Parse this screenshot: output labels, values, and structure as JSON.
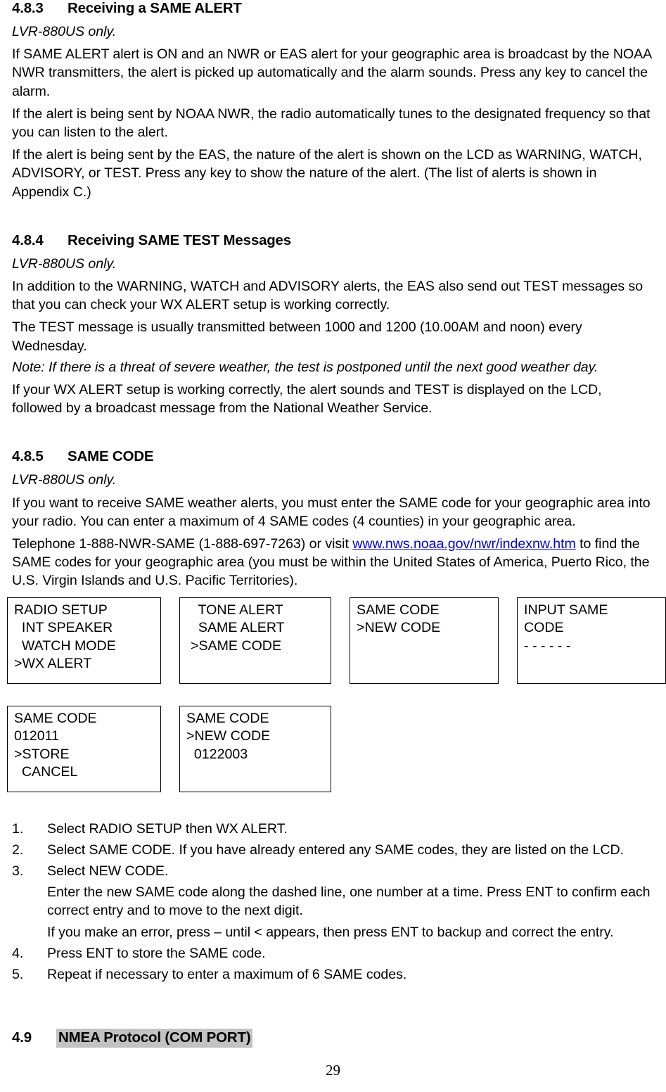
{
  "document": {
    "page_number": "29"
  },
  "sections": {
    "s483": {
      "number": "4.8.3",
      "title": "Receiving a SAME ALERT",
      "note": "LVR-880US only.",
      "paragraphs": [
        "If SAME ALERT alert is ON and an NWR or EAS alert for your geographic area is broadcast by the NOAA NWR transmitters, the alert is picked up automatically and the alarm sounds. Press any key to cancel the alarm.",
        "If the alert is being sent by NOAA NWR, the radio automatically tunes to the designated frequency so that you can listen to the alert.",
        "If the alert is being sent by the EAS, the nature of the alert is shown on the LCD as WARNING, WATCH, ADVISORY, or TEST. Press any key to show the nature of the alert. (The list of alerts is shown in Appendix C.)"
      ]
    },
    "s484": {
      "number": "4.8.4",
      "title": "Receiving SAME TEST Messages",
      "note": "LVR-880US only.",
      "paragraphs": [
        "In addition to the WARNING, WATCH and ADVISORY alerts, the EAS also send out TEST messages so that you can check your WX ALERT setup is working correctly.",
        "The TEST message is usually transmitted between 1000 and 1200 (10.00AM and noon) every Wednesday."
      ],
      "italic_note": "Note: If there is a threat of severe weather, the test is postponed until the next good weather day.",
      "closing": "If your WX ALERT setup is working correctly, the alert sounds and TEST is displayed on the LCD, followed by a broadcast message from the National Weather Service."
    },
    "s485": {
      "number": "4.8.5",
      "title": "SAME CODE",
      "note": "LVR-880US only.",
      "paragraph1": "If you want to receive SAME weather alerts, you must enter the SAME code for your geographic area into your radio. You can enter a maximum of 4 SAME codes (4 counties) in your geographic area.",
      "telephone_pre": "Telephone 1-888-NWR-SAME (1-888-697-7263) or visit ",
      "link_text": "www.nws.noaa.gov/nwr/indexnw.htm",
      "telephone_post": " to find the SAME codes for your geographic area (you must be within the United States of America, Puerto Rico, the U.S. Virgin Islands and U.S. Pacific Territories)."
    },
    "s49": {
      "number": "4.9",
      "title": "NMEA Protocol (COM PORT)",
      "highlight_color": "#c2c2c2"
    }
  },
  "lcd_screens": {
    "row1": [
      {
        "name": "radio-setup",
        "lines": [
          "RADIO SETUP",
          "  INT SPEAKER",
          "  WATCH MODE",
          ">WX ALERT"
        ]
      },
      {
        "name": "tone-alert",
        "lines": [
          "  TONE ALERT",
          "  SAME ALERT",
          ">SAME CODE",
          ""
        ]
      },
      {
        "name": "same-code-new",
        "lines": [
          "SAME CODE",
          ">NEW CODE",
          "",
          ""
        ]
      },
      {
        "name": "input-same-code",
        "lines": [
          "INPUT SAME",
          "CODE",
          "- - - - - -",
          ""
        ]
      }
    ],
    "row2": [
      {
        "name": "same-code-store",
        "lines": [
          "SAME CODE",
          "012011",
          ">STORE",
          "  CANCEL"
        ]
      },
      {
        "name": "same-code-entered",
        "lines": [
          "SAME CODE",
          ">NEW CODE",
          "  0122003",
          ""
        ]
      }
    ]
  },
  "steps": [
    {
      "marker": "1.",
      "text": "Select RADIO SETUP then WX ALERT."
    },
    {
      "marker": "2.",
      "text": "Select SAME CODE. If you have already entered any SAME codes, they are listed on the LCD."
    },
    {
      "marker": "3.",
      "text": "Select NEW CODE."
    }
  ],
  "step_sub": [
    "Enter the new SAME code along the dashed line, one number at a time. Press ENT to confirm each correct entry and to move to the next digit.",
    "If you make an error, press – until < appears, then press ENT to backup and correct the entry."
  ],
  "steps_tail": [
    {
      "marker": "4.",
      "text": "Press ENT to store the SAME code."
    },
    {
      "marker": "5.",
      "text": "Repeat if necessary to enter a maximum of 6 SAME codes."
    }
  ]
}
